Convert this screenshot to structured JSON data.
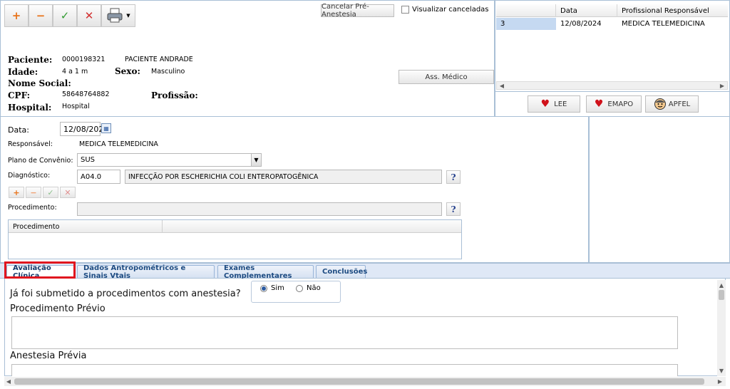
{
  "toolbar": {
    "add": "+",
    "remove": "−",
    "confirm": "✓",
    "cancel": "✕",
    "cancel_pre_label": "Cancelar Pré-Anestesia",
    "show_cancelled_label": "Visualizar canceladas"
  },
  "patient": {
    "paciente_label": "Paciente:",
    "paciente_id": "0000198321",
    "paciente_nome": "PACIENTE ANDRADE",
    "idade_label": "Idade:",
    "idade": "4 a 1 m",
    "sexo_label": "Sexo:",
    "sexo": "Masculino",
    "nome_social_label": "Nome Social:",
    "cpf_label": "CPF:",
    "cpf": "58648764882",
    "profissao_label": "Profissão:",
    "hospital_label": "Hospital:",
    "hospital": "Hospital",
    "ass_medico_label": "Ass. Médico"
  },
  "grid": {
    "headers": [
      "",
      "Data",
      "Profissional Responsável"
    ],
    "rows": [
      {
        "id": "3",
        "data": "12/08/2024",
        "prof": "MEDICA TELEMEDICINA"
      }
    ],
    "buttons": {
      "lee": "LEE",
      "emapo": "EMAPO",
      "apfel": "APFEL"
    }
  },
  "form": {
    "data_label": "Data:",
    "data_value": "12/08/202",
    "responsavel_label": "Responsável:",
    "responsavel_value": "MEDICA TELEMEDICINA",
    "plano_label": "Plano de Convênio:",
    "plano_value": "SUS",
    "diagnostico_label": "Diagnóstico:",
    "diagnostico_code": "A04.0",
    "diagnostico_desc": "INFECÇÃO POR ESCHERICHIA COLI ENTEROPATOGÊNICA",
    "help": "?",
    "procedimento_label": "Procedimento:",
    "procedimento_table_header": "Procedimento"
  },
  "tabs": [
    {
      "label": "Avaliação Clínica"
    },
    {
      "label": "Dados Antropométricos e Sinais Vtais"
    },
    {
      "label": "Exames Complementares"
    },
    {
      "label": "Conclusões"
    }
  ],
  "clinical": {
    "question": "Já foi submetido a procedimentos com anestesia?",
    "yes": "Sim",
    "no": "Não",
    "procedimento_previo": "Procedimento Prévio",
    "anestesia_previa": "Anestesia Prévia"
  },
  "colors": {
    "accent": "#1d4b82",
    "highlight": "#e0141e",
    "selected_row": "#c5d9f1"
  }
}
